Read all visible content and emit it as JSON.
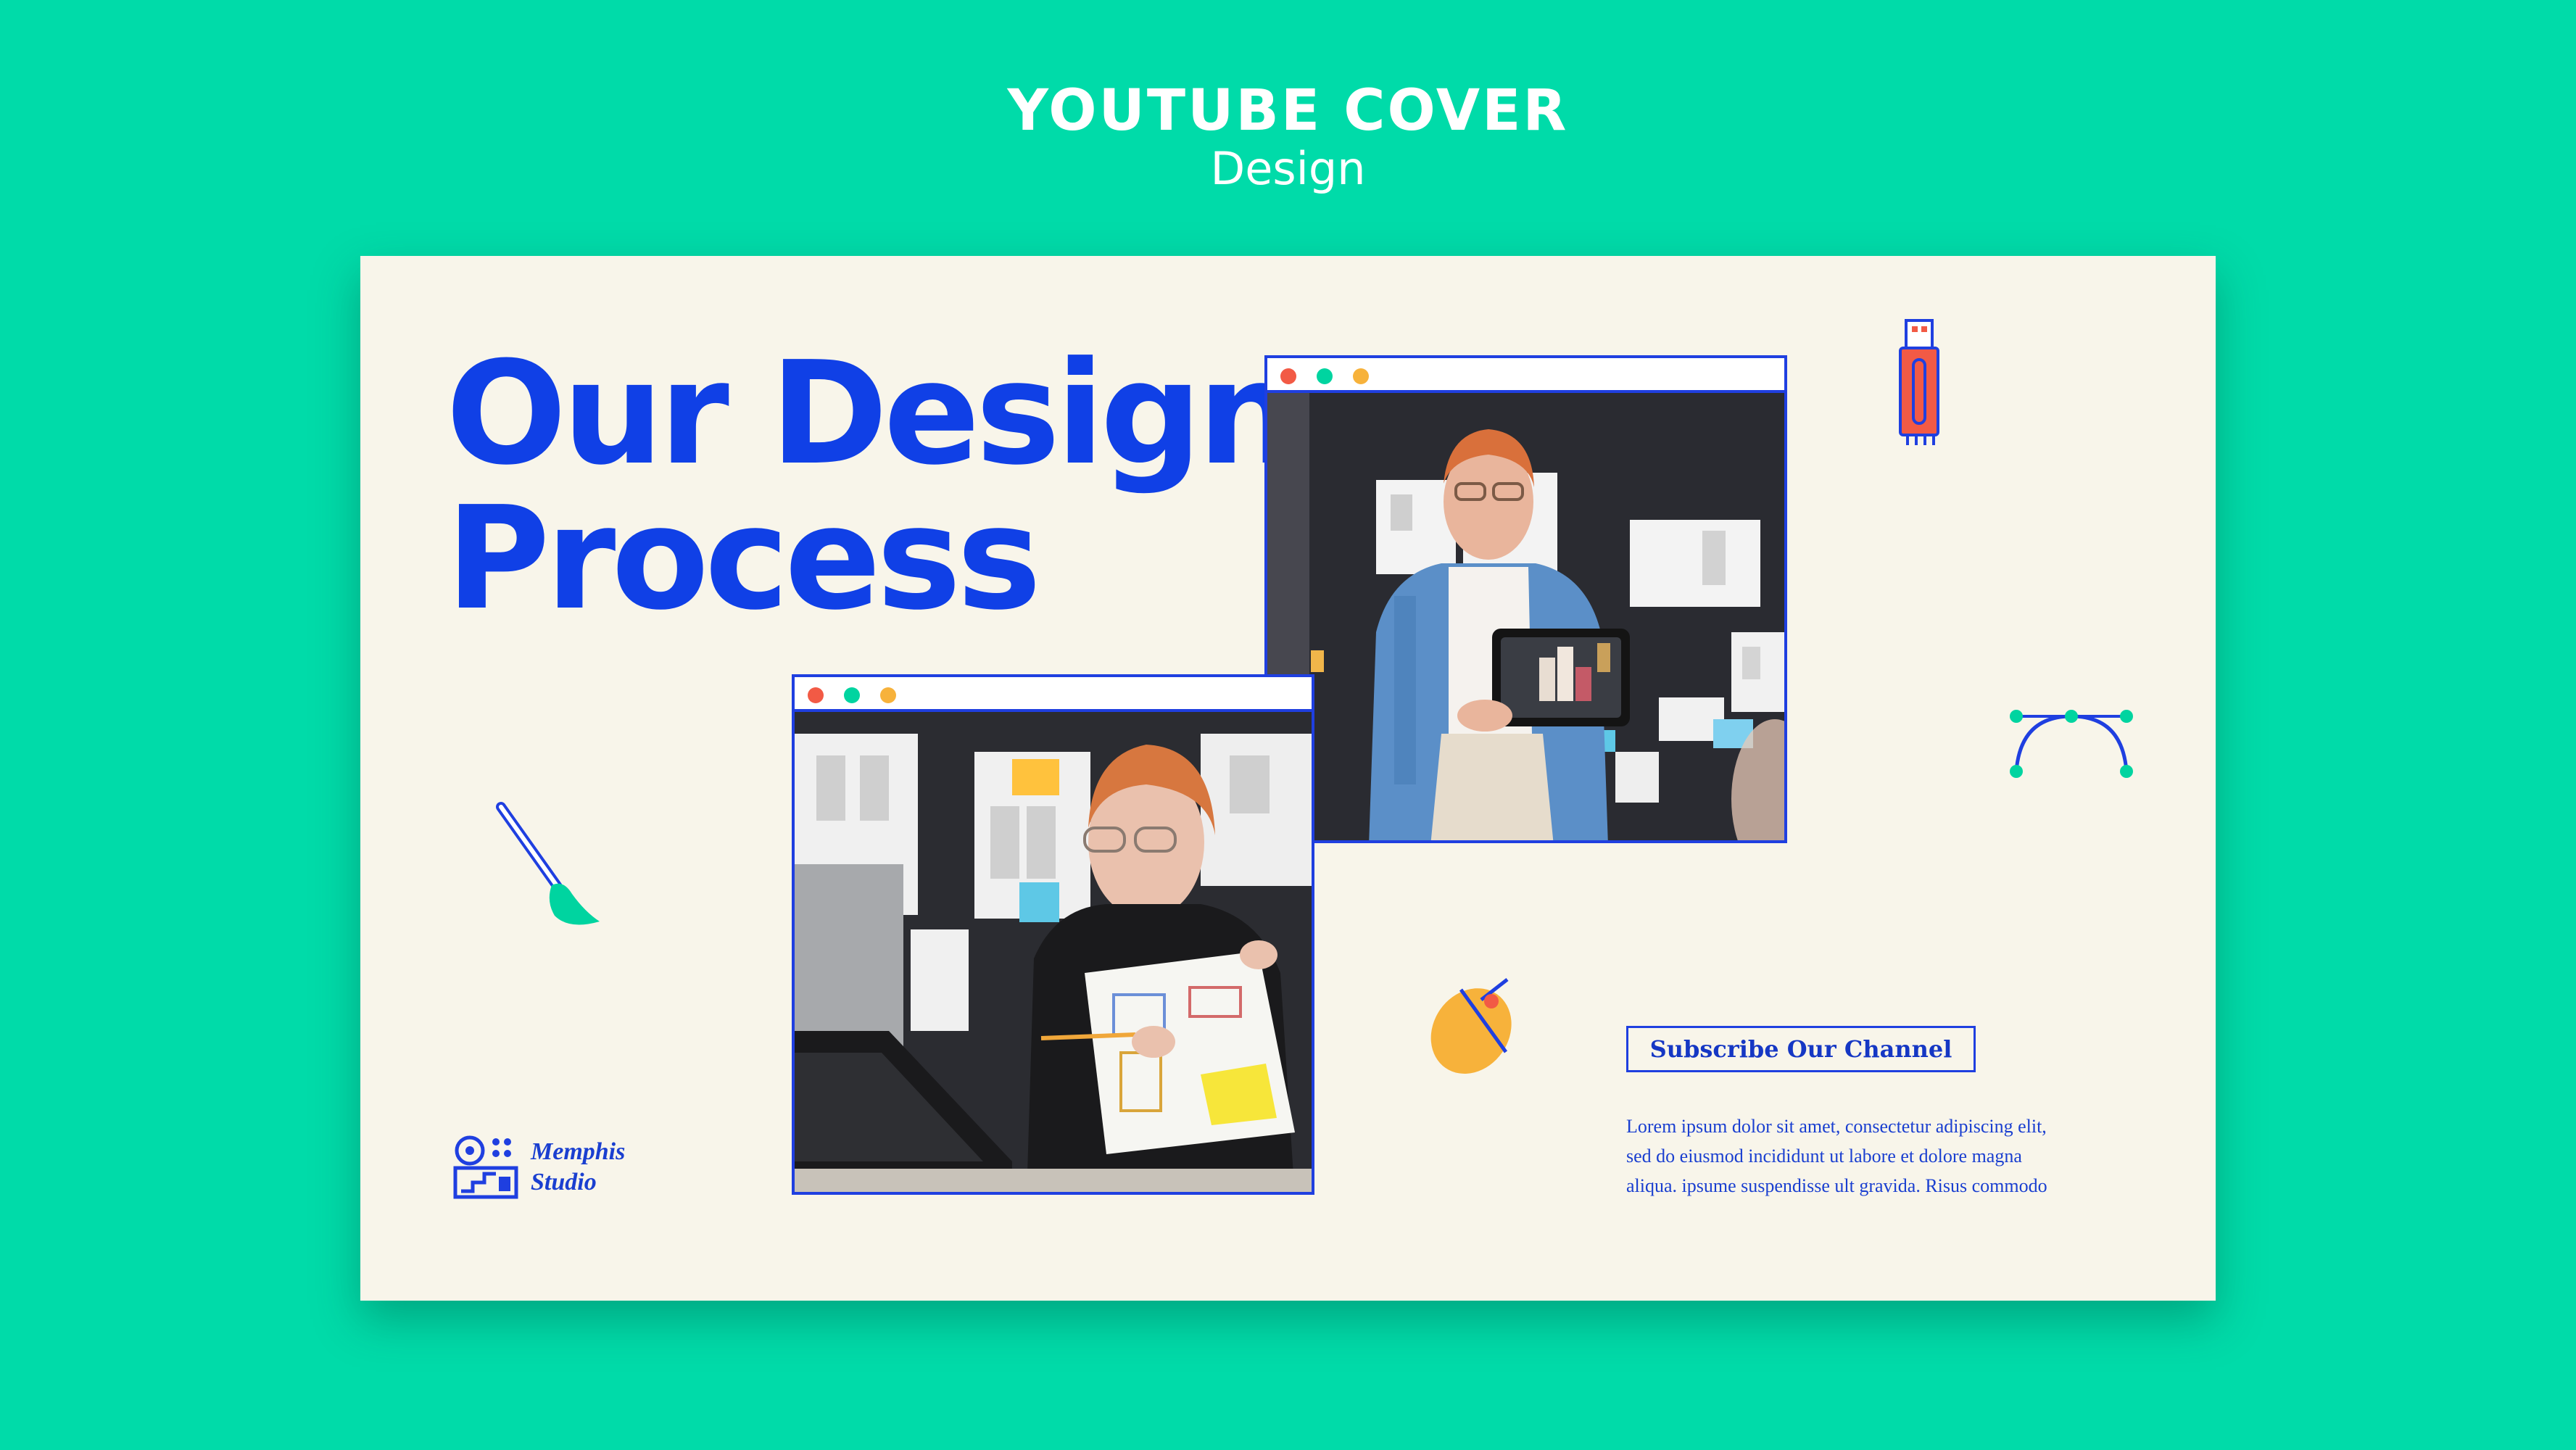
{
  "header": {
    "title": "YOUTUBE COVER",
    "subtitle": "Design"
  },
  "card": {
    "headline_line1": "Our Design",
    "headline_line2": "Process",
    "subscribe_label": "Subscribe Our Channel",
    "description_line1": "Lorem ipsum dolor sit amet, consectetur adipiscing elit,",
    "description_line2": "sed do eiusmod incididunt ut labore et dolore magna",
    "description_line3": "aliqua. ipsume suspendisse ult gravida. Risus commodo",
    "logo_line1": "Memphis",
    "logo_line2": "Studio"
  },
  "icons": [
    "usb-drive-icon",
    "bezier-curve-icon",
    "paintbrush-icon",
    "mouse-icon",
    "memphis-studio-logo-icon"
  ],
  "colors": {
    "background": "#00dba9",
    "card": "#f8f5ea",
    "accent_blue": "#1040e6",
    "dot_red": "#f25a45",
    "dot_green": "#00d4a0",
    "dot_yellow": "#f7b23b"
  }
}
